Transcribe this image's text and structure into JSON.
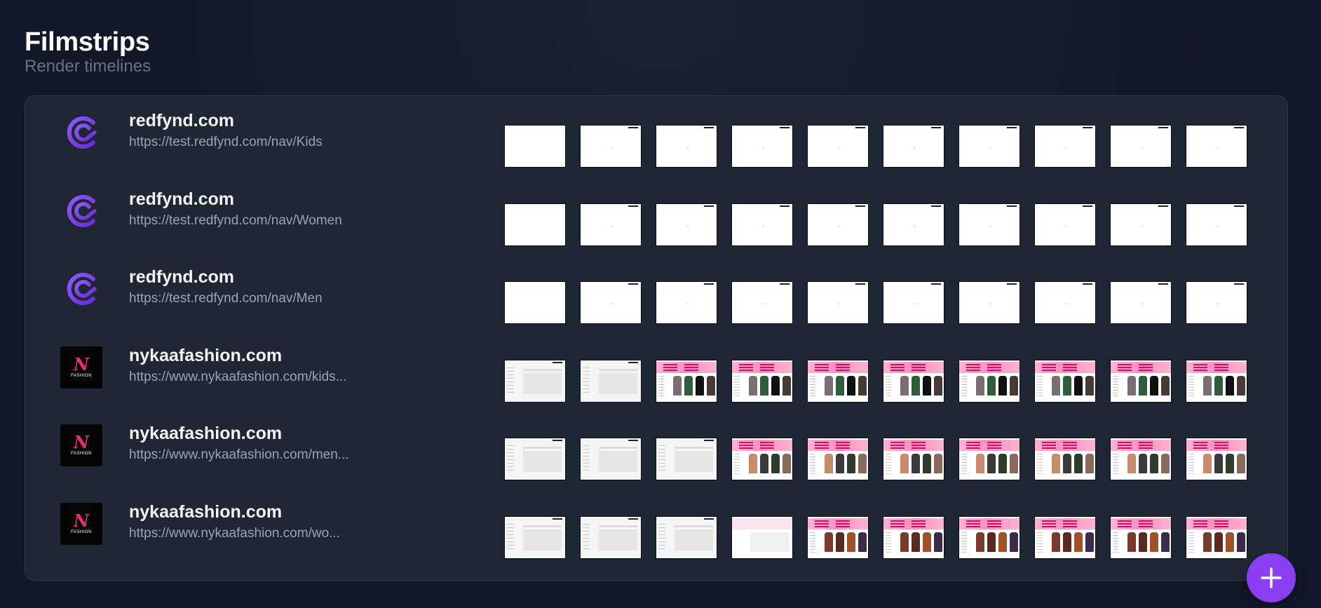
{
  "page": {
    "title": "Filmstrips",
    "subtitle": "Render timelines"
  },
  "rows": [
    {
      "site": "redfynd.com",
      "url": "https://test.redfynd.com/nav/Kids",
      "logo": "redfynd-logo",
      "frames": [
        "blank",
        "empty",
        "empty",
        "empty",
        "empty",
        "empty",
        "empty",
        "empty",
        "empty",
        "empty"
      ]
    },
    {
      "site": "redfynd.com",
      "url": "https://test.redfynd.com/nav/Women",
      "logo": "redfynd-logo",
      "frames": [
        "blank",
        "empty",
        "empty",
        "empty",
        "empty",
        "empty",
        "empty",
        "empty",
        "empty",
        "empty"
      ]
    },
    {
      "site": "redfynd.com",
      "url": "https://test.redfynd.com/nav/Men",
      "logo": "redfynd-logo",
      "frames": [
        "blank",
        "empty",
        "empty",
        "empty",
        "empty",
        "empty",
        "empty",
        "empty",
        "empty",
        "empty"
      ]
    },
    {
      "site": "nykaafashion.com",
      "url": "https://www.nykaafashion.com/kids...",
      "logo": "nykaa-fashion-logo",
      "frames": [
        "skeleton",
        "skeleton",
        "kids",
        "kids",
        "kids",
        "kids",
        "kids",
        "kids",
        "kids",
        "kids"
      ]
    },
    {
      "site": "nykaafashion.com",
      "url": "https://www.nykaafashion.com/men...",
      "logo": "nykaa-fashion-logo",
      "frames": [
        "skeleton",
        "skeleton",
        "skeleton",
        "men",
        "men",
        "men",
        "men",
        "men",
        "men",
        "men"
      ]
    },
    {
      "site": "nykaafashion.com",
      "url": "https://www.nykaafashion.com/wo...",
      "logo": "nykaa-fashion-logo",
      "frames": [
        "skeleton",
        "skeleton",
        "skeleton",
        "faint",
        "women",
        "women",
        "women",
        "women",
        "women",
        "women"
      ]
    }
  ],
  "logo_text": {
    "mark": "N",
    "word": "FASHION"
  },
  "fab": {
    "icon": "plus-icon"
  },
  "colors": {
    "background": "#111827",
    "panel": "#1f2735",
    "accent": "#8b3df2",
    "redfynd_logo": "#7c3aed",
    "nykaa_pink": "#e8306f"
  }
}
